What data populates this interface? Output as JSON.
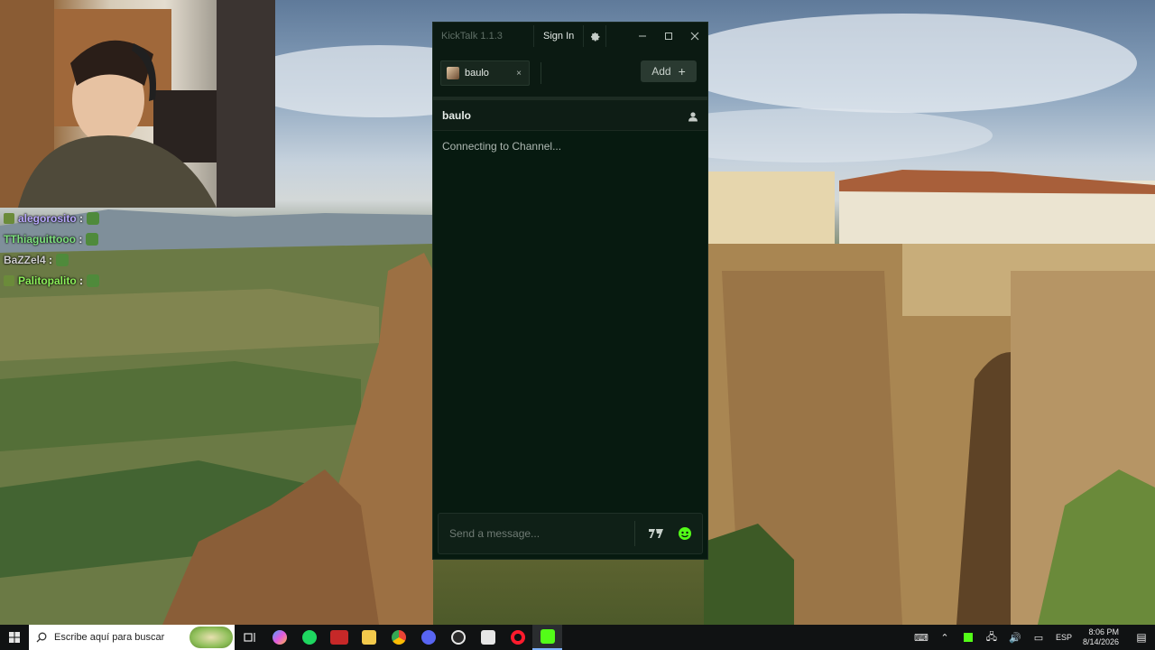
{
  "overlay_chat": [
    {
      "name": "alegorosito",
      "suffix": ":",
      "color": "#b9a9ff"
    },
    {
      "name": "TThiaguittooo",
      "suffix": ":",
      "color": "#7fe27f"
    },
    {
      "name": "BaZZel4",
      "suffix": ":",
      "color": "#cfcfcf"
    },
    {
      "name": "Palitopalito",
      "suffix": ":",
      "color": "#8cf05a"
    }
  ],
  "app": {
    "title": "KickTalk 1.1.3",
    "sign_in": "Sign In",
    "settings_icon": "gear-icon",
    "tabs": [
      {
        "label": "baulo",
        "close": "×"
      }
    ],
    "add_label": "Add",
    "add_plus": "+",
    "channel": {
      "name": "baulo",
      "status": "Connecting to Channel..."
    },
    "composer": {
      "placeholder": "Send a message..."
    },
    "accent": "#53fc18"
  },
  "taskbar": {
    "search_placeholder": "Escribe aquí para buscar",
    "language": "ESP",
    "time": "8:06 PM",
    "date": "8/14/2026",
    "apps": [
      "task-view",
      "copilot",
      "spotify",
      "video-app",
      "file-explorer",
      "chrome",
      "discord",
      "obs",
      "roblox",
      "opera",
      "kicktalk"
    ]
  }
}
